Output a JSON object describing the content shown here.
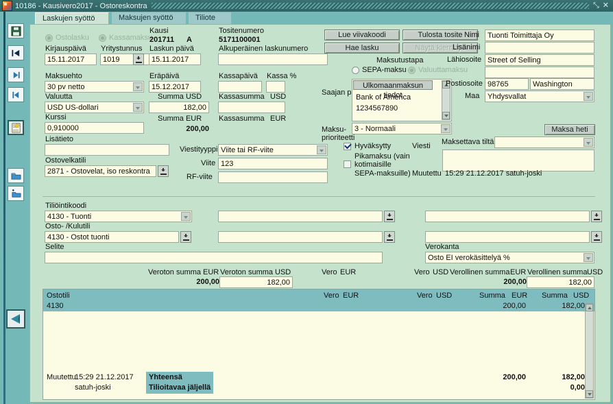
{
  "window": {
    "title": "10186 - Kausivero2017 - Ostoreskontra",
    "buttons": {
      "restore": "⤡",
      "close": "✕"
    }
  },
  "left_toolbar": {
    "items": [
      {
        "name": "save-icon",
        "label": "Tallenna"
      },
      {
        "name": "first-record-icon",
        "label": "Ensimmäinen"
      },
      {
        "name": "next-record-icon",
        "label": "Seuraava"
      },
      {
        "name": "previous-record-icon",
        "label": "Edellinen"
      },
      {
        "name": "new-document-icon",
        "label": "Uusi"
      },
      {
        "name": "open-folder-icon",
        "label": "Avaa"
      },
      {
        "name": "add-folder-icon",
        "label": "Lisää"
      },
      {
        "name": "exit-icon",
        "label": "Poistu"
      }
    ]
  },
  "tabs": [
    {
      "label": "Laskujen syöttö",
      "active": true
    },
    {
      "label": "Maksujen syöttö",
      "active": false
    },
    {
      "label": "Tiliote",
      "active": false
    }
  ],
  "form": {
    "radio_ostolasku": "Ostolasku",
    "radio_kassamaksu": "Kassamaksu",
    "kirjauspaiva_label": "Kirjauspäivä",
    "kirjauspaiva_value": "15.11.2017",
    "yritystunnus_label": "Yritystunnus",
    "yritystunnus_value": "1019",
    "kausi_label": "Kausi",
    "kausi_value": "201711",
    "kausi_suffix": "A",
    "laskun_paiva_label": "Laskun päivä",
    "laskun_paiva_value": "15.11.2017",
    "tositenumero_label": "Tositenumero",
    "tositenumero_value": "5171100001",
    "alkuperainen_label": "Alkuperäinen laskunumero",
    "alkuperainen_value": "",
    "maksuehto_label": "Maksuehto",
    "maksuehto_value": "30 pv netto",
    "erapaiva_label": "Eräpäivä",
    "erapaiva_value": "15.12.2017",
    "kassapaiva_label": "Kassapäivä",
    "kassapaiva_value": "",
    "kassa_pct_label": "Kassa %",
    "kassa_pct_value": "",
    "valuutta_label": "Valuutta",
    "valuutta_value": "USD US-dollari",
    "summa_usd_label": "Summa  USD",
    "summa_usd_value": "182,00",
    "kassasumma_usd_label": "Kassasumma",
    "kassasumma_usd_unit": "USD",
    "kassasumma_usd_value": "",
    "kurssi_label": "Kurssi",
    "kurssi_value": "0,910000",
    "summa_eur_label": "Summa  EUR",
    "summa_eur_value": "200,00",
    "kassasumma_eur_label": "Kassasumma",
    "kassasumma_eur_unit": "EUR",
    "kassasumma_eur_value": "",
    "lisatieto_label": "Lisätieto",
    "lisatieto_value": "",
    "ostovelkatili_label": "Ostovelkatili",
    "ostovelkatili_value": "2871 - Ostovelat, iso reskontra",
    "viestityyppi_label": "Viestityyppi",
    "viestityyppi_value": "Viite tai RF-viite",
    "viite_label": "Viite",
    "viite_value": "123",
    "rf_viite_label": "RF-viite",
    "rf_viite_value": ""
  },
  "actions": {
    "lue_viivakoodi": "Lue viivakoodi",
    "tulosta_tosite": "Tulosta tosite",
    "hae_lasku": "Hae lasku",
    "nayta_kierratys": "Näytä kierrätys",
    "maksa_heti": "Maksa heti"
  },
  "payment": {
    "maksutustapa_label": "Maksutustapa",
    "sepa_label": "SEPA-maksu",
    "valuutta_label": "Valuuttamaksu",
    "saajan_pankki_label": "Saajan pankki",
    "ulkomaanmaksun_tiedot": "Ulkomaanmaksun tiedot",
    "bank_name": "Bank of America",
    "bank_account": "1234567890",
    "maksu_prioriteetti_label": "Maksu-\nprioriteetti",
    "maksu_prioriteetti_line1": "Maksu-",
    "maksu_prioriteetti_line2": "prioriteetti",
    "maksu_prioriteetti_value": "3 - Normaali",
    "hyvaksytty_label": "Hyväksytty",
    "pikamaksu_line1": "Pikamaksu (vain",
    "pikamaksu_line2": "kotimaisille",
    "pikamaksu_line3": "SEPA-maksuille)",
    "viesti_label": "Viesti",
    "viesti_value": "",
    "maksettava_tilta_label": "Maksettava tiltä",
    "maksettava_tilta_value": "",
    "muutettu_label": "Muutettu",
    "muutettu_value": "15:29 21.12.2017  satuh-joski"
  },
  "supplier": {
    "nimi_label": "Nimi",
    "nimi_value": "Tuonti Toimittaja Oy",
    "lisanimi_label": "Lisänimi",
    "lisanimi_value": "",
    "lahiosoite_label": "Lähiosoite",
    "lahiosoite_value": "Street of Selling",
    "lahiosoite2_value": "",
    "postiosoite_label": "Postiosoite",
    "postinumero_value": "98765",
    "postitoimipaikka_value": "Washington",
    "maa_label": "Maa",
    "maa_value": "Yhdysvallat"
  },
  "accounting": {
    "tiliointikoodi_label": "Tiliöintikoodi",
    "tiliointikoodi_value": "4130 - Tuonti",
    "tiliointikoodi_extra1": "",
    "tiliointikoodi_extra2": "",
    "osto_kulutili_label": "Osto- /Kulutili",
    "osto_kulutili_value": "4130 - Ostot tuonti",
    "osto_kulutili_extra1": "",
    "osto_kulutili_extra2": "",
    "selite_label": "Selite",
    "selite_value": "",
    "verokanta_label": "Verokanta",
    "verokanta_value": "Osto EI verokäsittelyä %"
  },
  "totals_row": {
    "veroton_eur_label": "Veroton summa",
    "veroton_eur_unit": "EUR",
    "veroton_eur_value": "200,00",
    "veroton_usd_label": "Veroton summa",
    "veroton_usd_unit": "USD",
    "veroton_usd_value": "182,00",
    "vero_eur_label": "Vero",
    "vero_eur_unit": "EUR",
    "vero_eur_value": "",
    "vero_usd_label": "Vero",
    "vero_usd_unit": "USD",
    "vero_usd_value": "",
    "verollinen_eur_label": "Verollinen summa",
    "verollinen_eur_unit": "EUR",
    "verollinen_eur_value": "200,00",
    "verollinen_usd_label": "Verollinen summa",
    "verollinen_usd_unit": "USD",
    "verollinen_usd_value": "182,00"
  },
  "grid": {
    "headers": {
      "ostotili": "Ostotili",
      "vero_eur_1": "Vero",
      "vero_eur_2": "EUR",
      "vero_usd_1": "Vero",
      "vero_usd_2": "USD",
      "summa_eur_1": "Summa",
      "summa_eur_2": "EUR",
      "summa_usd_1": "Summa",
      "summa_usd_2": "USD"
    },
    "rows": [
      {
        "ostotili": "4130",
        "vero_eur": "",
        "vero_usd": "",
        "summa_eur": "200,00",
        "summa_usd": "182,00"
      }
    ]
  },
  "footer": {
    "muutettu_label": "Muutettu",
    "muutettu_time": "15:29 21.12.2017",
    "muutettu_user": "satuh-joski",
    "yhteensa_label": "Yhteensä",
    "tilioitavaa_label": "Tilioitavaa jäljellä",
    "yhteensa_eur": "200,00",
    "yhteensa_usd": "182,00",
    "jaljella_usd": "0,00"
  },
  "colors": {
    "panel_bg": "#c5e2cc",
    "field_bg": "#fcfbe3",
    "accent_teal": "#7fbcc0",
    "title_bar": "#2f6363"
  }
}
